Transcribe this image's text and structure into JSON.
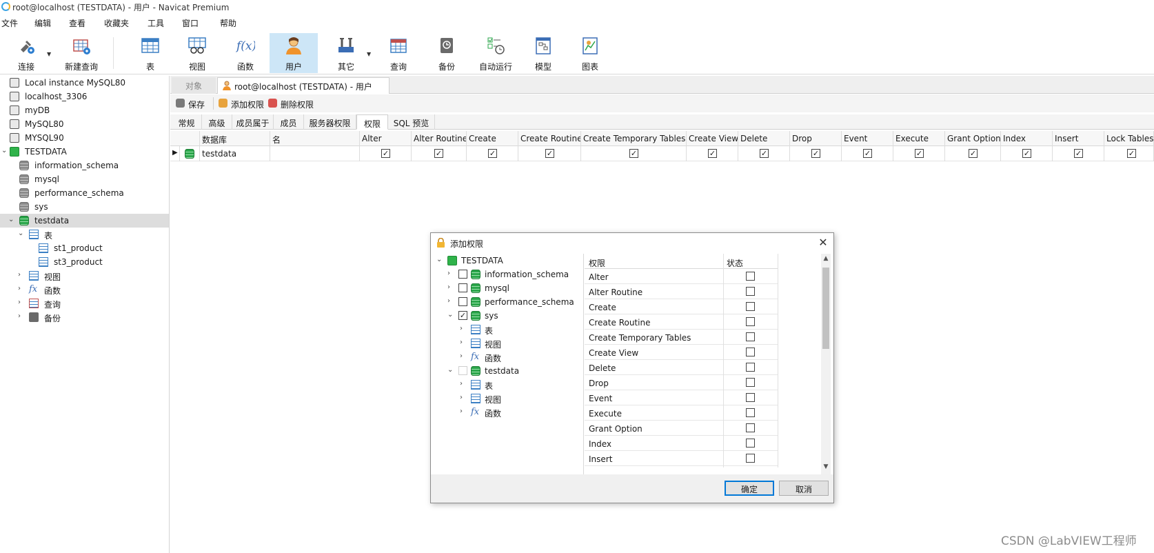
{
  "window": {
    "title": "root@localhost (TESTDATA) - 用户 - Navicat Premium"
  },
  "menu": [
    "文件",
    "编辑",
    "查看",
    "收藏夹",
    "工具",
    "窗口",
    "帮助"
  ],
  "toolbar": {
    "items": [
      {
        "label": "连接",
        "icon": "connect-plug-icon"
      },
      {
        "label": "新建查询",
        "icon": "new-query-icon"
      },
      {
        "label": "表",
        "icon": "table-icon"
      },
      {
        "label": "视图",
        "icon": "view-icon"
      },
      {
        "label": "函数",
        "icon": "function-icon",
        "glyph": "f(x)"
      },
      {
        "label": "用户",
        "icon": "user-icon",
        "active": true
      },
      {
        "label": "其它",
        "icon": "tools-icon"
      },
      {
        "label": "查询",
        "icon": "query-icon"
      },
      {
        "label": "备份",
        "icon": "backup-icon"
      },
      {
        "label": "自动运行",
        "icon": "auto-run-icon"
      },
      {
        "label": "模型",
        "icon": "model-icon"
      },
      {
        "label": "图表",
        "icon": "chart-icon"
      }
    ]
  },
  "navigator": {
    "connections": [
      "Local instance MySQL80",
      "localhost_3306",
      "myDB",
      "MySQL80",
      "MYSQL90",
      "TESTDATA"
    ],
    "databases": [
      "information_schema",
      "mysql",
      "performance_schema",
      "sys",
      "testdata"
    ],
    "testdata_children": {
      "tables_label": "表",
      "tables": [
        "st1_product",
        "st3_product"
      ],
      "views_label": "视图",
      "functions_label": "函数",
      "queries_label": "查询",
      "backups_label": "备份",
      "fx_glyph": "fx"
    }
  },
  "tabs": {
    "objects": "对象",
    "active": "root@localhost (TESTDATA) - 用户"
  },
  "actions": {
    "save": "保存",
    "add_privilege": "添加权限",
    "delete_privilege": "删除权限"
  },
  "page_tabs": [
    "常规",
    "高级",
    "成员属于",
    "成员",
    "服务器权限",
    "权限",
    "SQL 预览"
  ],
  "active_page_tab": "权限",
  "grid": {
    "columns": [
      "数据库",
      "名",
      "Alter",
      "Alter Routine",
      "Create",
      "Create Routine",
      "Create Temporary Tables",
      "Create View",
      "Delete",
      "Drop",
      "Event",
      "Execute",
      "Grant Option",
      "Index",
      "Insert",
      "Lock Tables"
    ],
    "row": {
      "database": "testdata",
      "name": "",
      "checked": [
        true,
        true,
        true,
        true,
        true,
        true,
        true,
        true,
        true,
        true,
        true,
        true,
        true,
        true
      ]
    }
  },
  "dialog": {
    "title": "添加权限",
    "tree": {
      "root": "TESTDATA",
      "databases": [
        {
          "name": "information_schema",
          "checked": false,
          "expanded": false
        },
        {
          "name": "mysql",
          "checked": false,
          "expanded": false
        },
        {
          "name": "performance_schema",
          "checked": false,
          "expanded": false
        },
        {
          "name": "sys",
          "checked": true,
          "expanded": true
        },
        {
          "name": "testdata",
          "checked": false,
          "expanded": true
        }
      ],
      "child_labels": [
        "表",
        "视图",
        "函数"
      ]
    },
    "privilege_header": "权限",
    "status_header": "状态",
    "privileges": [
      {
        "name": "Alter",
        "checked": false
      },
      {
        "name": "Alter Routine",
        "checked": false
      },
      {
        "name": "Create",
        "checked": false
      },
      {
        "name": "Create Routine",
        "checked": false
      },
      {
        "name": "Create Temporary Tables",
        "checked": false
      },
      {
        "name": "Create View",
        "checked": false
      },
      {
        "name": "Delete",
        "checked": false
      },
      {
        "name": "Drop",
        "checked": false
      },
      {
        "name": "Event",
        "checked": false
      },
      {
        "name": "Execute",
        "checked": false
      },
      {
        "name": "Grant Option",
        "checked": false
      },
      {
        "name": "Index",
        "checked": false
      },
      {
        "name": "Insert",
        "checked": false
      }
    ],
    "ok": "确定",
    "cancel": "取消"
  },
  "watermark": "CSDN @LabVIEW工程师",
  "colors": {
    "accent": "#0078d7",
    "active_tool": "#cde6f7",
    "db_green": "#2aa64a"
  }
}
